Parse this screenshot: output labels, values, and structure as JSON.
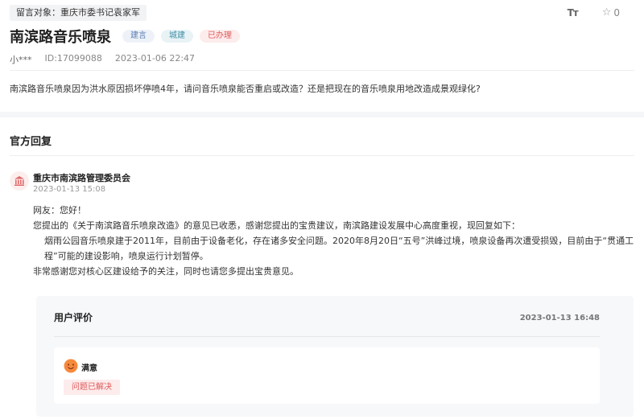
{
  "header": {
    "target_label": "留言对象：重庆市委书记袁家军",
    "font_size_icon": "Tт",
    "star_count": "0"
  },
  "message": {
    "title": "南滨路音乐喷泉",
    "tags": [
      {
        "label": "建言",
        "color": "#5a7fb5"
      },
      {
        "label": "城建",
        "color": "#3f8fa8"
      },
      {
        "label": "已办理",
        "color": "#e05858"
      }
    ],
    "user": "小***",
    "id": "ID:17099088",
    "time": "2023-01-06 22:47",
    "content": "南滨路音乐喷泉因为洪水原因损坏停喷4年，请问音乐喷泉能否重启或改造？还是把现在的音乐喷泉用地改造成景观绿化?"
  },
  "reply": {
    "heading": "官方回复",
    "org_name": "重庆市南滨路管理委员会",
    "org_time": "2023-01-13 15:08",
    "org_icon": "government-building-icon",
    "paragraphs": [
      "网友：您好！",
      "您提出的《关于南滨路音乐喷泉改造》的意见已收悉，感谢您提出的宝贵建议，南滨路建设发展中心高度重视，现回复如下：",
      "烟雨公园音乐喷泉建于2011年，目前由于设备老化，存在诸多安全问题。2020年8月20日“五号”洪峰过境，喷泉设备再次遭受损毁，目前由于“贯通工程”可能的建设影响，喷泉运行计划暂停。",
      "非常感谢您对核心区建设给予的关注，同时也请您多提出宝贵意见。"
    ]
  },
  "evaluation": {
    "title": "用户评价",
    "time": "2023-01-13 16:48",
    "rating_icon": "smiley-face-icon",
    "rating_label": "满意",
    "resolved_label": "问题已解决"
  }
}
